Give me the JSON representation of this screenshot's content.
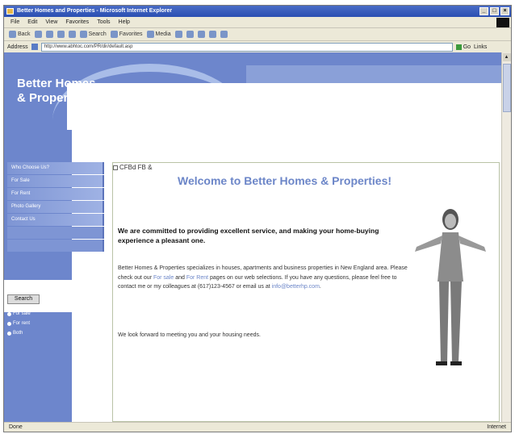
{
  "window": {
    "title": "Better Homes and Properties - Microsoft Internet Explorer"
  },
  "menu": [
    "File",
    "Edit",
    "View",
    "Favorites",
    "Tools",
    "Help"
  ],
  "toolbar": {
    "back": "Back",
    "search": "Search",
    "favorites": "Favorites",
    "media": "Media"
  },
  "address": {
    "label": "Address",
    "url": "http://www.abhtoc.com/PR/dir/default.asp",
    "go": "Go",
    "links": "Links"
  },
  "page": {
    "brand_line1": "Better Homes",
    "brand_line2": "& Properties",
    "nav": [
      "Who Choose Us?",
      "For Sale",
      "For Rent",
      "Photo Gallery",
      "Contact Us"
    ],
    "search_button": "Search",
    "radios": [
      "For sale",
      "For rent",
      "Both"
    ],
    "broken_image_text": "CFBd FB &",
    "welcome": "Welcome to Better Homes & Properties!",
    "commitment": "We are committed to providing excellent service, and making your home-buying experience a pleasant one.",
    "body_pre": "Better Homes & Properties specializes in houses, apartments and business properties in New England area.  Please check out our ",
    "link_sale": "For sale",
    "body_mid": " and ",
    "link_rent": "For Rent",
    "body_post": " pages on our web selections.  If you have any questions, please feel free to contact me or my colleagues at (617)123-4567 or email us at ",
    "link_email": "info@betterhp.com",
    "body_end": ".",
    "closing": "We look forward to meeting you and your housing needs."
  },
  "status": {
    "left": "Done",
    "right": "Internet"
  }
}
